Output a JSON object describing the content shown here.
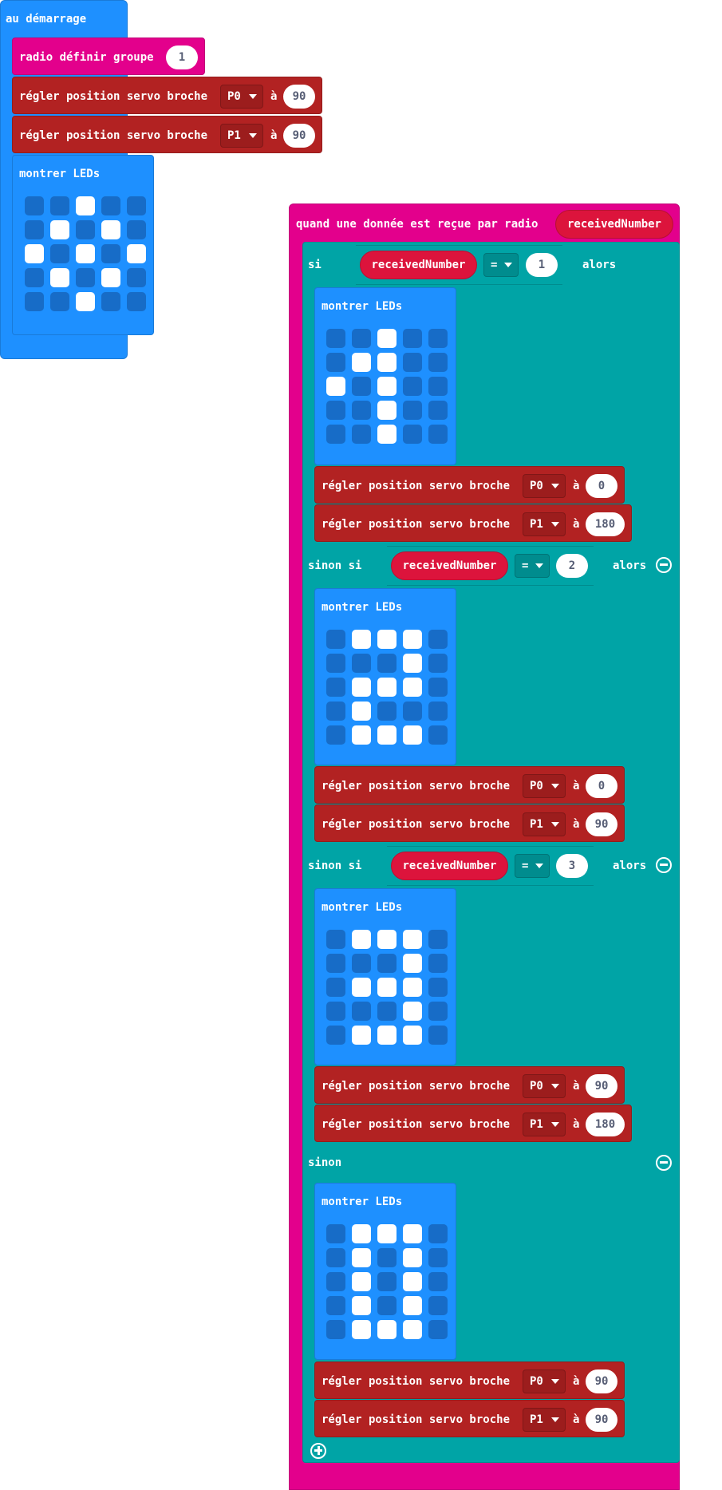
{
  "on_start": {
    "label": "au démarrage",
    "radio_group_label": "radio définir groupe",
    "radio_group_value": "1",
    "servo1": {
      "label": "régler position servo broche",
      "pin": "P0",
      "a": "à",
      "value": "90"
    },
    "servo2": {
      "label": "régler position servo broche",
      "pin": "P1",
      "a": "à",
      "value": "90"
    },
    "leds_label": "montrer LEDs",
    "leds": [
      [
        0,
        0,
        1,
        0,
        0
      ],
      [
        0,
        1,
        0,
        1,
        0
      ],
      [
        1,
        0,
        1,
        0,
        1
      ],
      [
        0,
        1,
        0,
        1,
        0
      ],
      [
        0,
        0,
        1,
        0,
        0
      ]
    ]
  },
  "on_radio": {
    "label": "quand une donnée est reçue par radio",
    "param": "receivedNumber",
    "si": "si",
    "sinon_si": "sinon si",
    "sinon": "sinon",
    "alors": "alors",
    "op": "=",
    "var": "receivedNumber",
    "branches": [
      {
        "value": "1",
        "leds_label": "montrer LEDs",
        "leds": [
          [
            0,
            0,
            1,
            0,
            0
          ],
          [
            0,
            1,
            1,
            0,
            0
          ],
          [
            1,
            0,
            1,
            0,
            0
          ],
          [
            0,
            0,
            1,
            0,
            0
          ],
          [
            0,
            0,
            1,
            0,
            0
          ]
        ],
        "servo1": {
          "label": "régler position servo broche",
          "pin": "P0",
          "a": "à",
          "value": "0"
        },
        "servo2": {
          "label": "régler position servo broche",
          "pin": "P1",
          "a": "à",
          "value": "180"
        }
      },
      {
        "value": "2",
        "leds_label": "montrer LEDs",
        "leds": [
          [
            0,
            1,
            1,
            1,
            0
          ],
          [
            0,
            0,
            0,
            1,
            0
          ],
          [
            0,
            1,
            1,
            1,
            0
          ],
          [
            0,
            1,
            0,
            0,
            0
          ],
          [
            0,
            1,
            1,
            1,
            0
          ]
        ],
        "servo1": {
          "label": "régler position servo broche",
          "pin": "P0",
          "a": "à",
          "value": "0"
        },
        "servo2": {
          "label": "régler position servo broche",
          "pin": "P1",
          "a": "à",
          "value": "90"
        }
      },
      {
        "value": "3",
        "leds_label": "montrer LEDs",
        "leds": [
          [
            0,
            1,
            1,
            1,
            0
          ],
          [
            0,
            0,
            0,
            1,
            0
          ],
          [
            0,
            1,
            1,
            1,
            0
          ],
          [
            0,
            0,
            0,
            1,
            0
          ],
          [
            0,
            1,
            1,
            1,
            0
          ]
        ],
        "servo1": {
          "label": "régler position servo broche",
          "pin": "P0",
          "a": "à",
          "value": "90"
        },
        "servo2": {
          "label": "régler position servo broche",
          "pin": "P1",
          "a": "à",
          "value": "180"
        }
      },
      {
        "leds_label": "montrer LEDs",
        "leds": [
          [
            0,
            1,
            1,
            1,
            0
          ],
          [
            0,
            1,
            0,
            1,
            0
          ],
          [
            0,
            1,
            0,
            1,
            0
          ],
          [
            0,
            1,
            0,
            1,
            0
          ],
          [
            0,
            1,
            1,
            1,
            0
          ]
        ],
        "servo1": {
          "label": "régler position servo broche",
          "pin": "P0",
          "a": "à",
          "value": "90"
        },
        "servo2": {
          "label": "régler position servo broche",
          "pin": "P1",
          "a": "à",
          "value": "90"
        }
      }
    ]
  },
  "colors": {
    "basic": "#1e90ff",
    "radio": "#e3008c",
    "servo": "#b22222",
    "logic": "#00a4a6",
    "variable": "#dc143c"
  }
}
